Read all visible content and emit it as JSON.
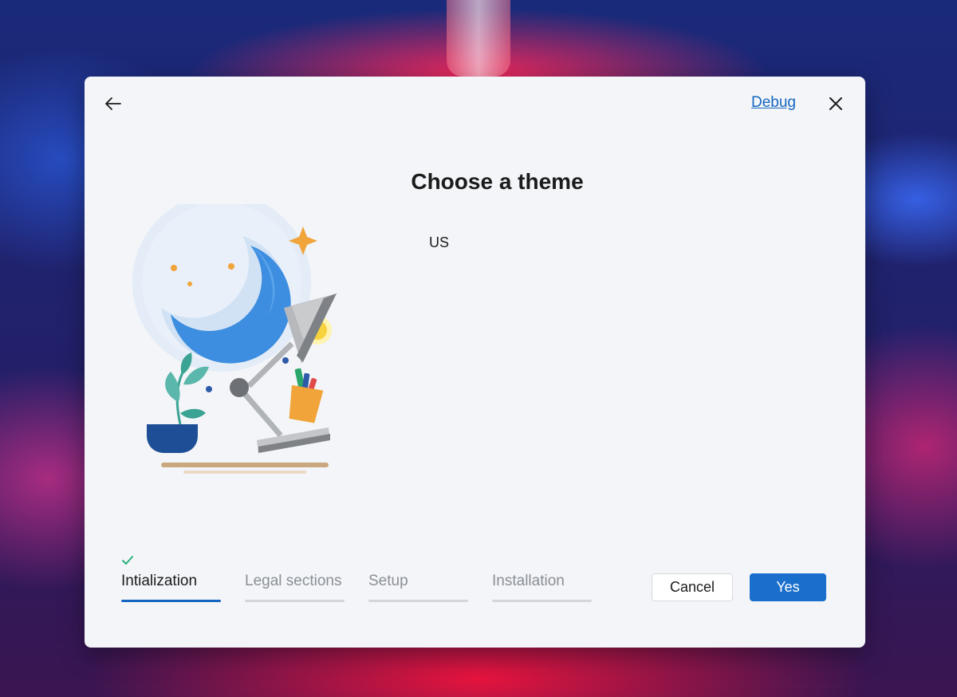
{
  "header": {
    "debug_label": "Debug"
  },
  "title": "Choose a theme",
  "region": "US",
  "steps": [
    {
      "label": "Intialization",
      "state": "completed"
    },
    {
      "label": "Legal sections",
      "state": "pending"
    },
    {
      "label": "Setup",
      "state": "pending"
    },
    {
      "label": "Installation",
      "state": "pending"
    }
  ],
  "buttons": {
    "cancel": "Cancel",
    "yes": "Yes"
  },
  "colors": {
    "accent": "#1566c0",
    "primary_button": "#1a6fcc",
    "check": "#2bb07a"
  },
  "icons": [
    "back-arrow-icon",
    "close-icon",
    "checkmark-icon"
  ]
}
